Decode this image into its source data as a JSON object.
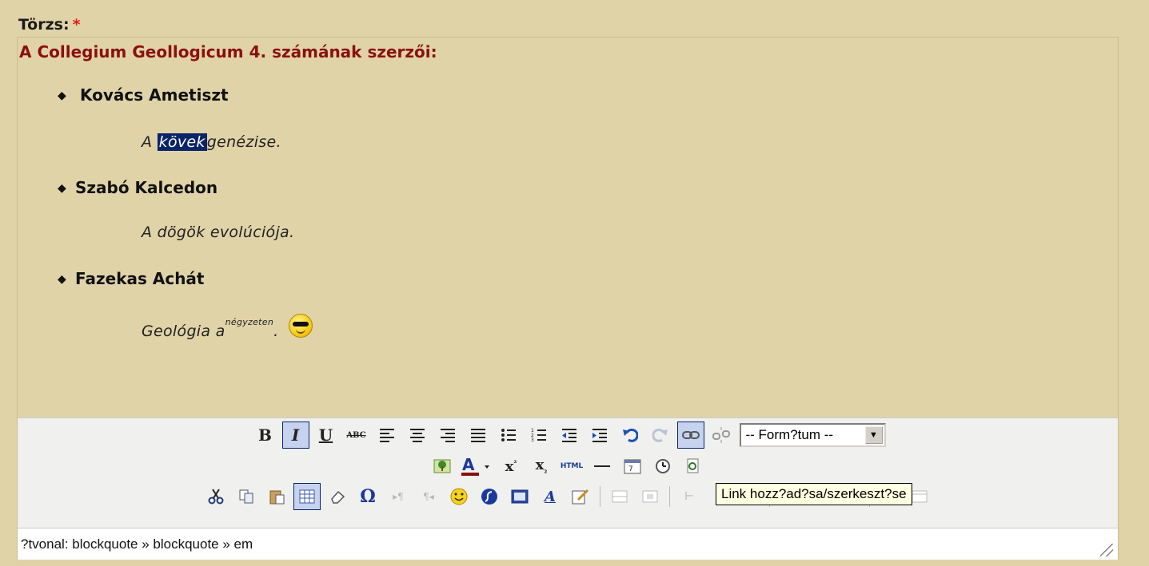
{
  "field": {
    "label": "Törzs:",
    "required_mark": "*"
  },
  "content": {
    "heading": "A Collegium Geollogicum 4. számának szerzői:",
    "entries": [
      {
        "name": "Kovács Ametiszt",
        "title_prefix": "A",
        "title_selected": "kövek",
        "title_rest": "genézise."
      },
      {
        "name": "Szabó  Kalcedon",
        "title": "A dögök evolúciója."
      },
      {
        "name": "Fazekas Achát",
        "title_main": "Geológia a",
        "title_sup": "négyzeten",
        "title_end": "."
      }
    ]
  },
  "toolbar": {
    "bold": "B",
    "italic": "I",
    "underline": "U",
    "strike": "ABC",
    "html": "HTML",
    "omega": "Ω",
    "format_select": "-- Form?tum --",
    "row1_icons": [
      "bold-icon",
      "italic-icon",
      "underline-icon",
      "strikethrough-icon",
      "align-left-icon",
      "align-center-icon",
      "align-right-icon",
      "justify-icon",
      "bullet-list-icon",
      "numbered-list-icon",
      "outdent-icon",
      "indent-icon",
      "undo-icon",
      "redo-icon",
      "link-icon",
      "unlink-icon"
    ],
    "row2_icons": [
      "image-icon",
      "font-color-icon",
      "superscript-icon",
      "subscript-icon",
      "html-icon",
      "horizontal-rule-icon",
      "insert-date-icon",
      "insert-time-icon",
      "preview-icon"
    ],
    "row3_icons": [
      "cut-icon",
      "copy-icon",
      "paste-icon",
      "table-icon",
      "eraser-icon",
      "special-char-icon",
      "ltr-icon",
      "rtl-icon",
      "emoticon-icon",
      "flash-icon",
      "media-icon",
      "style-icon",
      "edit-icon"
    ]
  },
  "tooltip": "Link hozz?ad?sa/szerkeszt?se",
  "status": {
    "path": "?tvonal: blockquote » blockquote » em"
  },
  "colors": {
    "background": "#e0d3a8",
    "heading": "#8a1010",
    "selection": "#0a246a",
    "required": "#e01b1b"
  }
}
